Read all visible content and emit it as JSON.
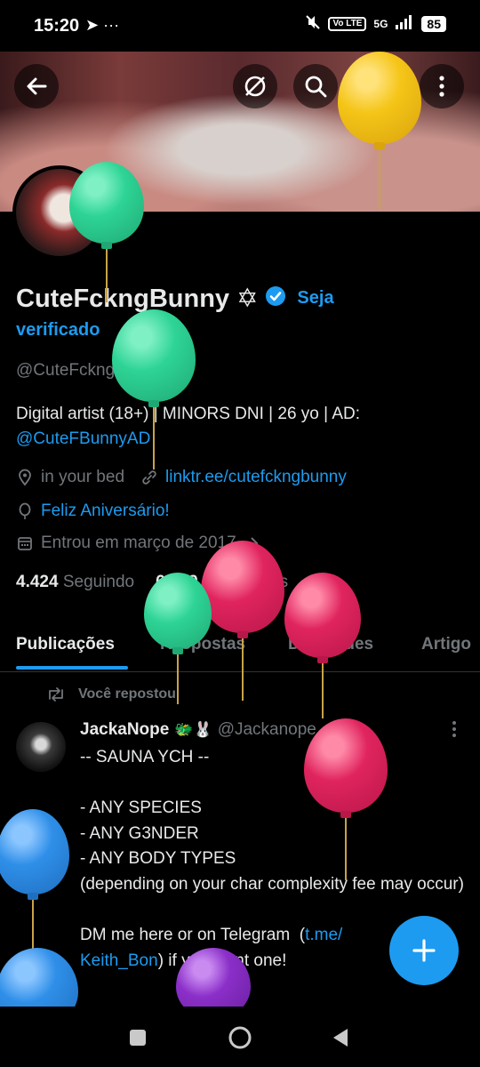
{
  "status_bar": {
    "time": "15:20",
    "left_icons": "➤ ···",
    "volte": "Vo LTE",
    "network": "5G",
    "battery": "85"
  },
  "header": {
    "icons": [
      "back-arrow-icon",
      "grok-icon",
      "search-icon",
      "edit-icon",
      "more-vertical-icon"
    ]
  },
  "profile": {
    "display_name": "CuteFckngBunny ✡",
    "verify_cta_line1": "Seja",
    "verify_cta_line2": "verificado",
    "handle": "@CuteFckngBunny",
    "bio_text": "Digital artist (18+) | MINORS DNI | 26 yo | AD:",
    "bio_link": "@CuteFBunnyAD",
    "location": "in your bed",
    "website": "linktr.ee/cutefckngbunny",
    "birthday": "Feliz Aniversário!",
    "joined": "Entrou em março de 2017",
    "following_count": "4.424",
    "following_label": "Seguindo",
    "followers_count": "6.679",
    "followers_label": "Seguidores"
  },
  "tabs": [
    {
      "label": "Publicações",
      "active": true
    },
    {
      "label": "Respostas",
      "active": false
    },
    {
      "label": "Destaques",
      "active": false
    },
    {
      "label": "Artigo",
      "active": false
    }
  ],
  "feed": {
    "repost_label": "Você repostou",
    "post": {
      "author_name": "JackaNope",
      "author_emoji": "🐲🐰",
      "author_handle": "@Jackanope · 2d",
      "body_text": "-- SAUNA YCH --\n\n- ANY SPECIES\n- ANY G3NDER\n- ANY BODY TYPES\n(depending on your char complexity fee may occur)\n\nDM me here or on Telegram  (",
      "body_link": "t.me/\nKeith_Bon",
      "body_tail": ") if you want one!"
    }
  },
  "colors": {
    "accent": "#1d9bf0",
    "muted": "#71767b",
    "text": "#e7e9ea",
    "background": "#000000",
    "balloon_green": "#2ed495",
    "balloon_red": "#e0245e",
    "balloon_yellow": "#f5c518",
    "balloon_blue": "#2f8fe8",
    "balloon_purple": "#8b2fc9"
  }
}
